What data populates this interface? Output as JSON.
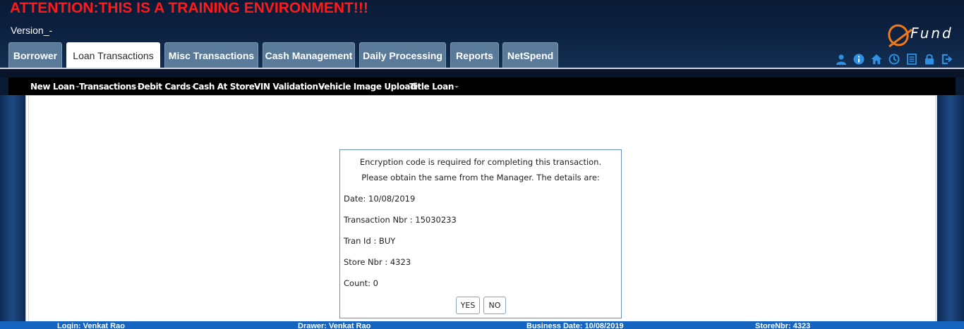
{
  "banner": {
    "attention": "ATTENTION:THIS IS A TRAINING ENVIRONMENT!!!"
  },
  "header": {
    "version": "Version_-",
    "logo_text": "Fund"
  },
  "tabs": [
    {
      "label": "Borrower"
    },
    {
      "label": "Loan Transactions",
      "active": true
    },
    {
      "label": "Misc Transactions"
    },
    {
      "label": "Cash Management"
    },
    {
      "label": "Daily Processing"
    },
    {
      "label": "Reports"
    },
    {
      "label": "NetSpend"
    }
  ],
  "toolbar_icons": [
    "user-icon",
    "info-icon",
    "home-icon",
    "clock-icon",
    "document-icon",
    "lock-icon",
    "logout-icon"
  ],
  "subnav": [
    {
      "label": "New Loan"
    },
    {
      "label": "Transactions"
    },
    {
      "label": "Debit Cards"
    },
    {
      "label": "Cash At Store"
    },
    {
      "label": "VIN Validation"
    },
    {
      "label": "Vehicle Image Upload"
    },
    {
      "label": "Title Loan"
    }
  ],
  "dialog": {
    "line1": "Encryption code is required for completing this transaction.",
    "line2": "Please obtain the same from the Manager. The details are:",
    "date": "Date: 10/08/2019",
    "transaction_nbr": "Transaction Nbr : 15030233",
    "tran_id": "Tran Id : BUY",
    "store_nbr": "Store Nbr : 4323",
    "count": "Count: 0",
    "yes_label": "YES",
    "no_label": "NO"
  },
  "footer": {
    "login": "Login: Venkat Rao",
    "drawer": "Drawer: Venkat Rao",
    "business_date": "Business Date: 10/08/2019",
    "store_nbr": "StoreNbr: 4323"
  },
  "colors": {
    "attention": "#ff1a1a",
    "tab_bg": "#5a7a99",
    "footer_bg": "#1565c0",
    "icon_blue": "#2f8fe0",
    "logo_orange": "#f07a1a"
  }
}
